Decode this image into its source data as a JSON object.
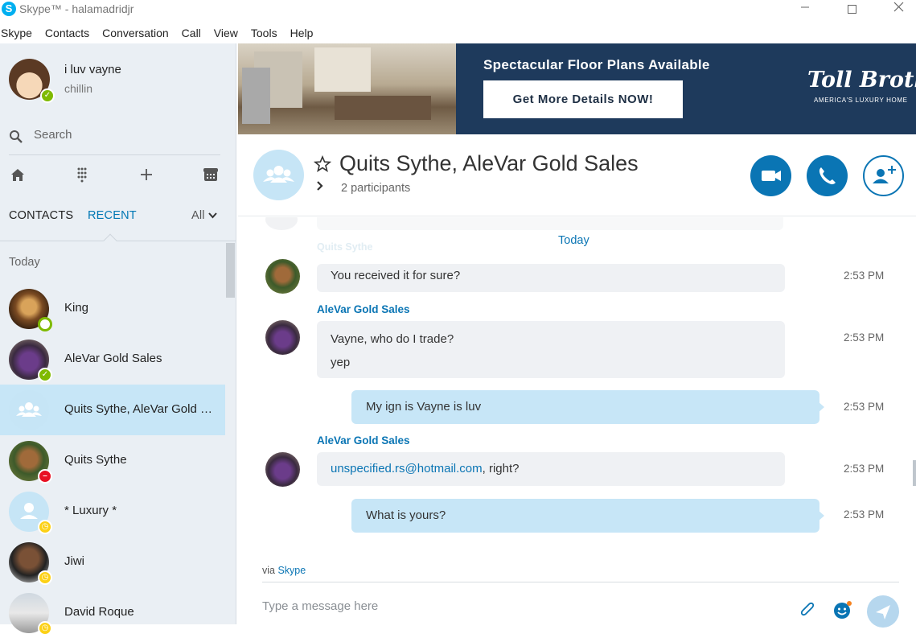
{
  "window": {
    "title": "Skype™ - halamadridjr",
    "app_logo": "S"
  },
  "menubar": [
    "Skype",
    "Contacts",
    "Conversation",
    "Call",
    "View",
    "Tools",
    "Help"
  ],
  "profile": {
    "name": "i luv vayne",
    "mood": "chillin",
    "status": "online"
  },
  "sidebar": {
    "search_label": "Search",
    "tabs": {
      "contacts": "CONTACTS",
      "recent": "RECENT",
      "filter": "All"
    },
    "section": "Today",
    "contacts": [
      {
        "name": "King",
        "status": "available-ring"
      },
      {
        "name": "AleVar Gold Sales",
        "status": "online"
      },
      {
        "name": "Quits Sythe, AleVar Gold Sales",
        "status": "group",
        "selected": true
      },
      {
        "name": "Quits Sythe",
        "status": "busy"
      },
      {
        "name": "* Luxury *",
        "status": "away"
      },
      {
        "name": "Jiwi",
        "status": "away"
      },
      {
        "name": "David Roque",
        "status": "away"
      }
    ]
  },
  "ad": {
    "headline": "Spectacular Floor Plans Available",
    "cta": "Get More Details NOW!",
    "brand": "Toll Broth",
    "tagline": "AMERICA'S LUXURY HOME"
  },
  "conversation": {
    "title": "Quits Sythe, AleVar Gold Sales",
    "participants": "2 participants",
    "faded_sender": "Quits Sythe",
    "day": "Today",
    "messages": [
      {
        "text": "You received it for sure?",
        "time": "2:53 PM"
      },
      {
        "sender": "AleVar Gold Sales",
        "lines": [
          "Vayne, who do I trade?",
          "yep"
        ],
        "time": "2:53 PM"
      },
      {
        "text": "My ign is Vayne is luv",
        "time": "2:53 PM"
      },
      {
        "sender": "AleVar Gold Sales",
        "link": "unspecified.rs@hotmail.com",
        "text": ", right?",
        "time": "2:53 PM"
      },
      {
        "text": "What is yours?",
        "time": "2:53 PM"
      }
    ]
  },
  "footer": {
    "via": "via",
    "via_link": "Skype",
    "placeholder": "Type a message here"
  },
  "colors": {
    "accent": "#0a75b4",
    "selected": "#c7e6f7",
    "sidebar": "#eaeff4",
    "online": "#7fba00",
    "busy": "#e81123",
    "away": "#fcd116"
  }
}
